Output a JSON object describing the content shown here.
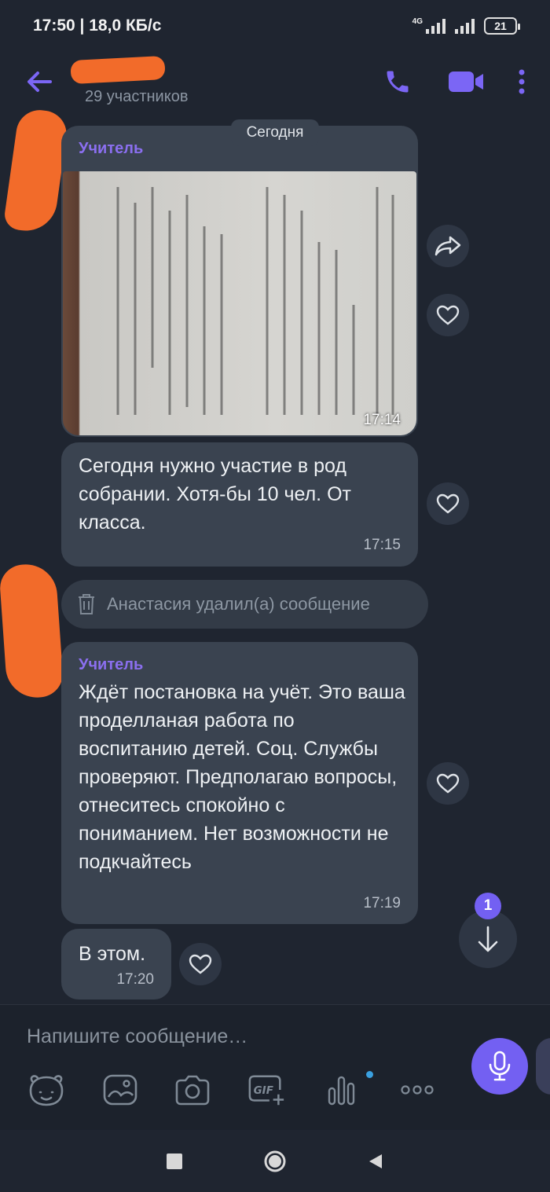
{
  "status_bar": {
    "time_speed": "17:50 | 18,0 КБ/с",
    "network": "4G",
    "battery": "21"
  },
  "header": {
    "members": "29 участников",
    "icons": [
      "back-arrow-icon",
      "phone-icon",
      "video-icon",
      "more-vertical-icon"
    ]
  },
  "date_separator": "Сегодня",
  "messages": [
    {
      "sender": "Учитель",
      "type": "photo",
      "time": "17:14"
    },
    {
      "type": "text",
      "text": "Сегодня нужно участие в род собрании. Хотя-бы 10 чел. От класса.",
      "time": "17:15"
    },
    {
      "type": "deleted",
      "text": "Анастасия удалил(а) сообщение"
    },
    {
      "sender": "Учитель",
      "type": "text",
      "text": "Ждёт постановка на учёт. Это ваша проделланая работа по воспитанию детей. Соц. Службы проверяют. Предполагаю вопросы, отнеситесь спокойно с пониманием. Нет возможности не подкчайтесь",
      "time": "17:19"
    },
    {
      "type": "text",
      "text": "В этом.",
      "time": "17:20"
    }
  ],
  "scroll_badge": "1",
  "composer": {
    "placeholder": "Напишите сообщение…",
    "tools": [
      "sticker-icon",
      "gallery-icon",
      "camera-icon",
      "gif-icon",
      "audio-icon",
      "more-icon"
    ]
  },
  "colors": {
    "background": "#1f2530",
    "bubble": "#3a4350",
    "accent": "#7360f2",
    "sender": "#8b6ff0",
    "redaction": "#f26b2a"
  }
}
